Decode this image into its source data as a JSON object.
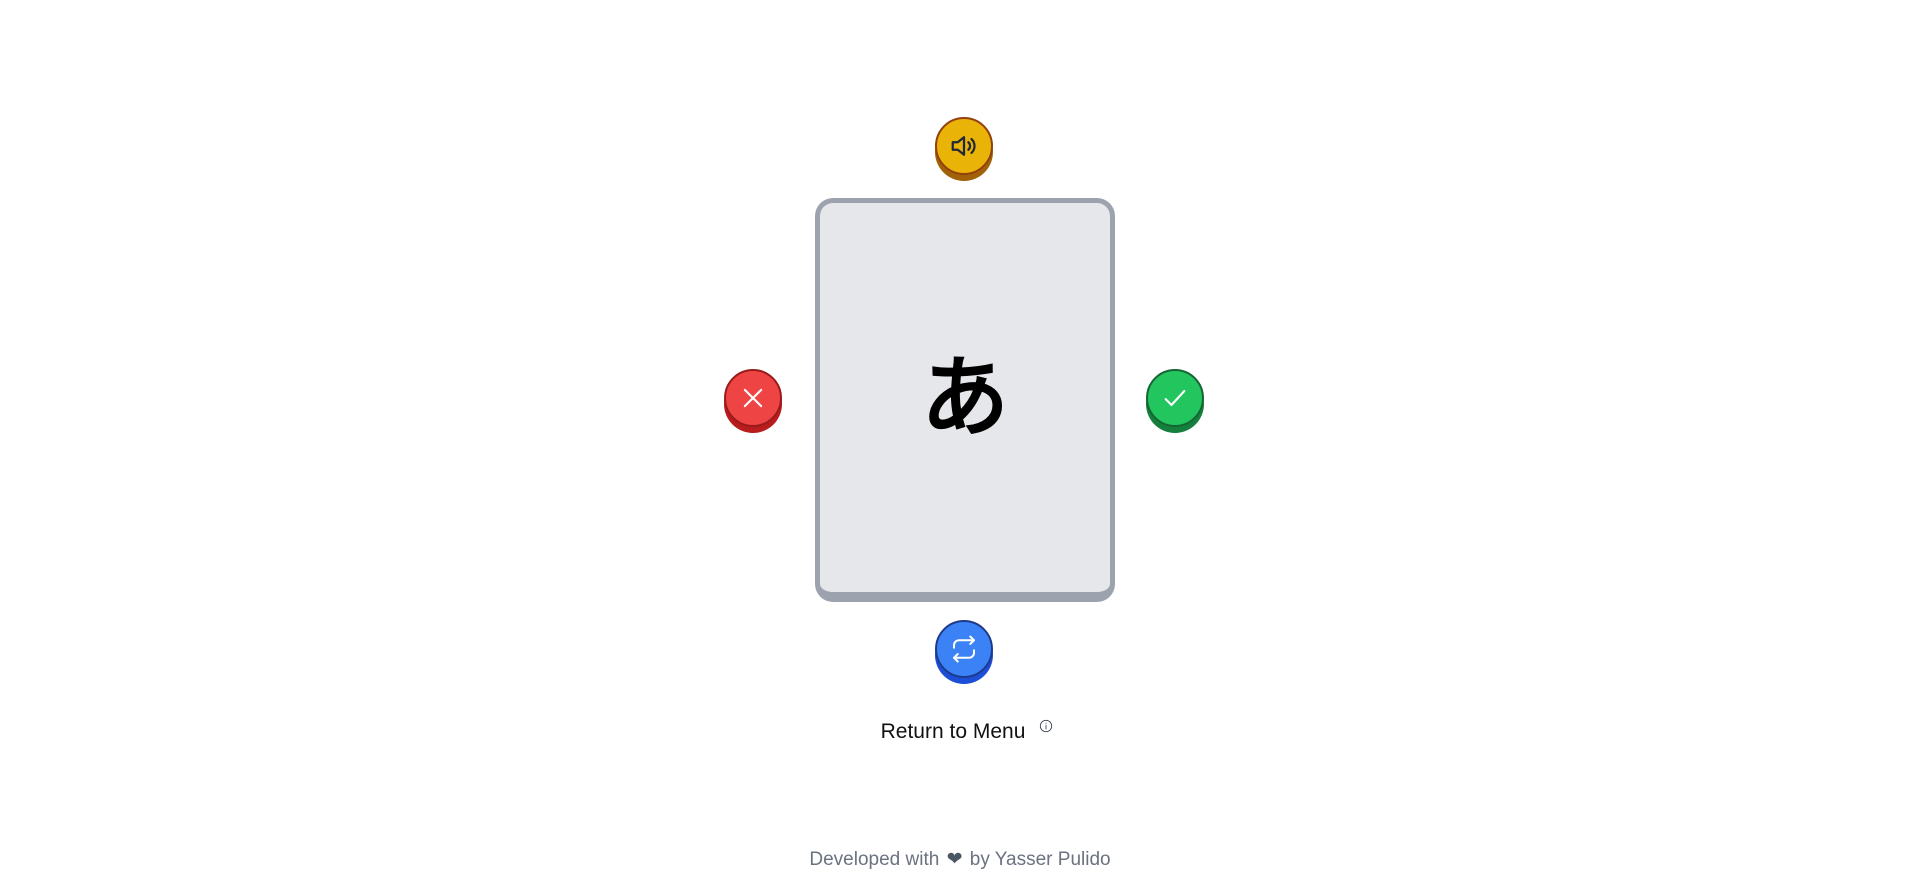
{
  "flashcard": {
    "character": "あ"
  },
  "buttons": {
    "audio_icon": "speaker-icon",
    "wrong_icon": "x-icon",
    "correct_icon": "check-icon",
    "flip_icon": "repeat-icon"
  },
  "menu": {
    "return_label": "Return to Menu",
    "info_icon": "info-icon"
  },
  "footer": {
    "prefix": "Developed with",
    "heart": "❤",
    "suffix": "by Yasser Pulido"
  },
  "colors": {
    "audio": "#eab308",
    "wrong": "#ef4444",
    "correct": "#22c55e",
    "flip": "#3b82f6",
    "card_bg": "#e5e7eb",
    "card_border": "#9ca3af"
  }
}
